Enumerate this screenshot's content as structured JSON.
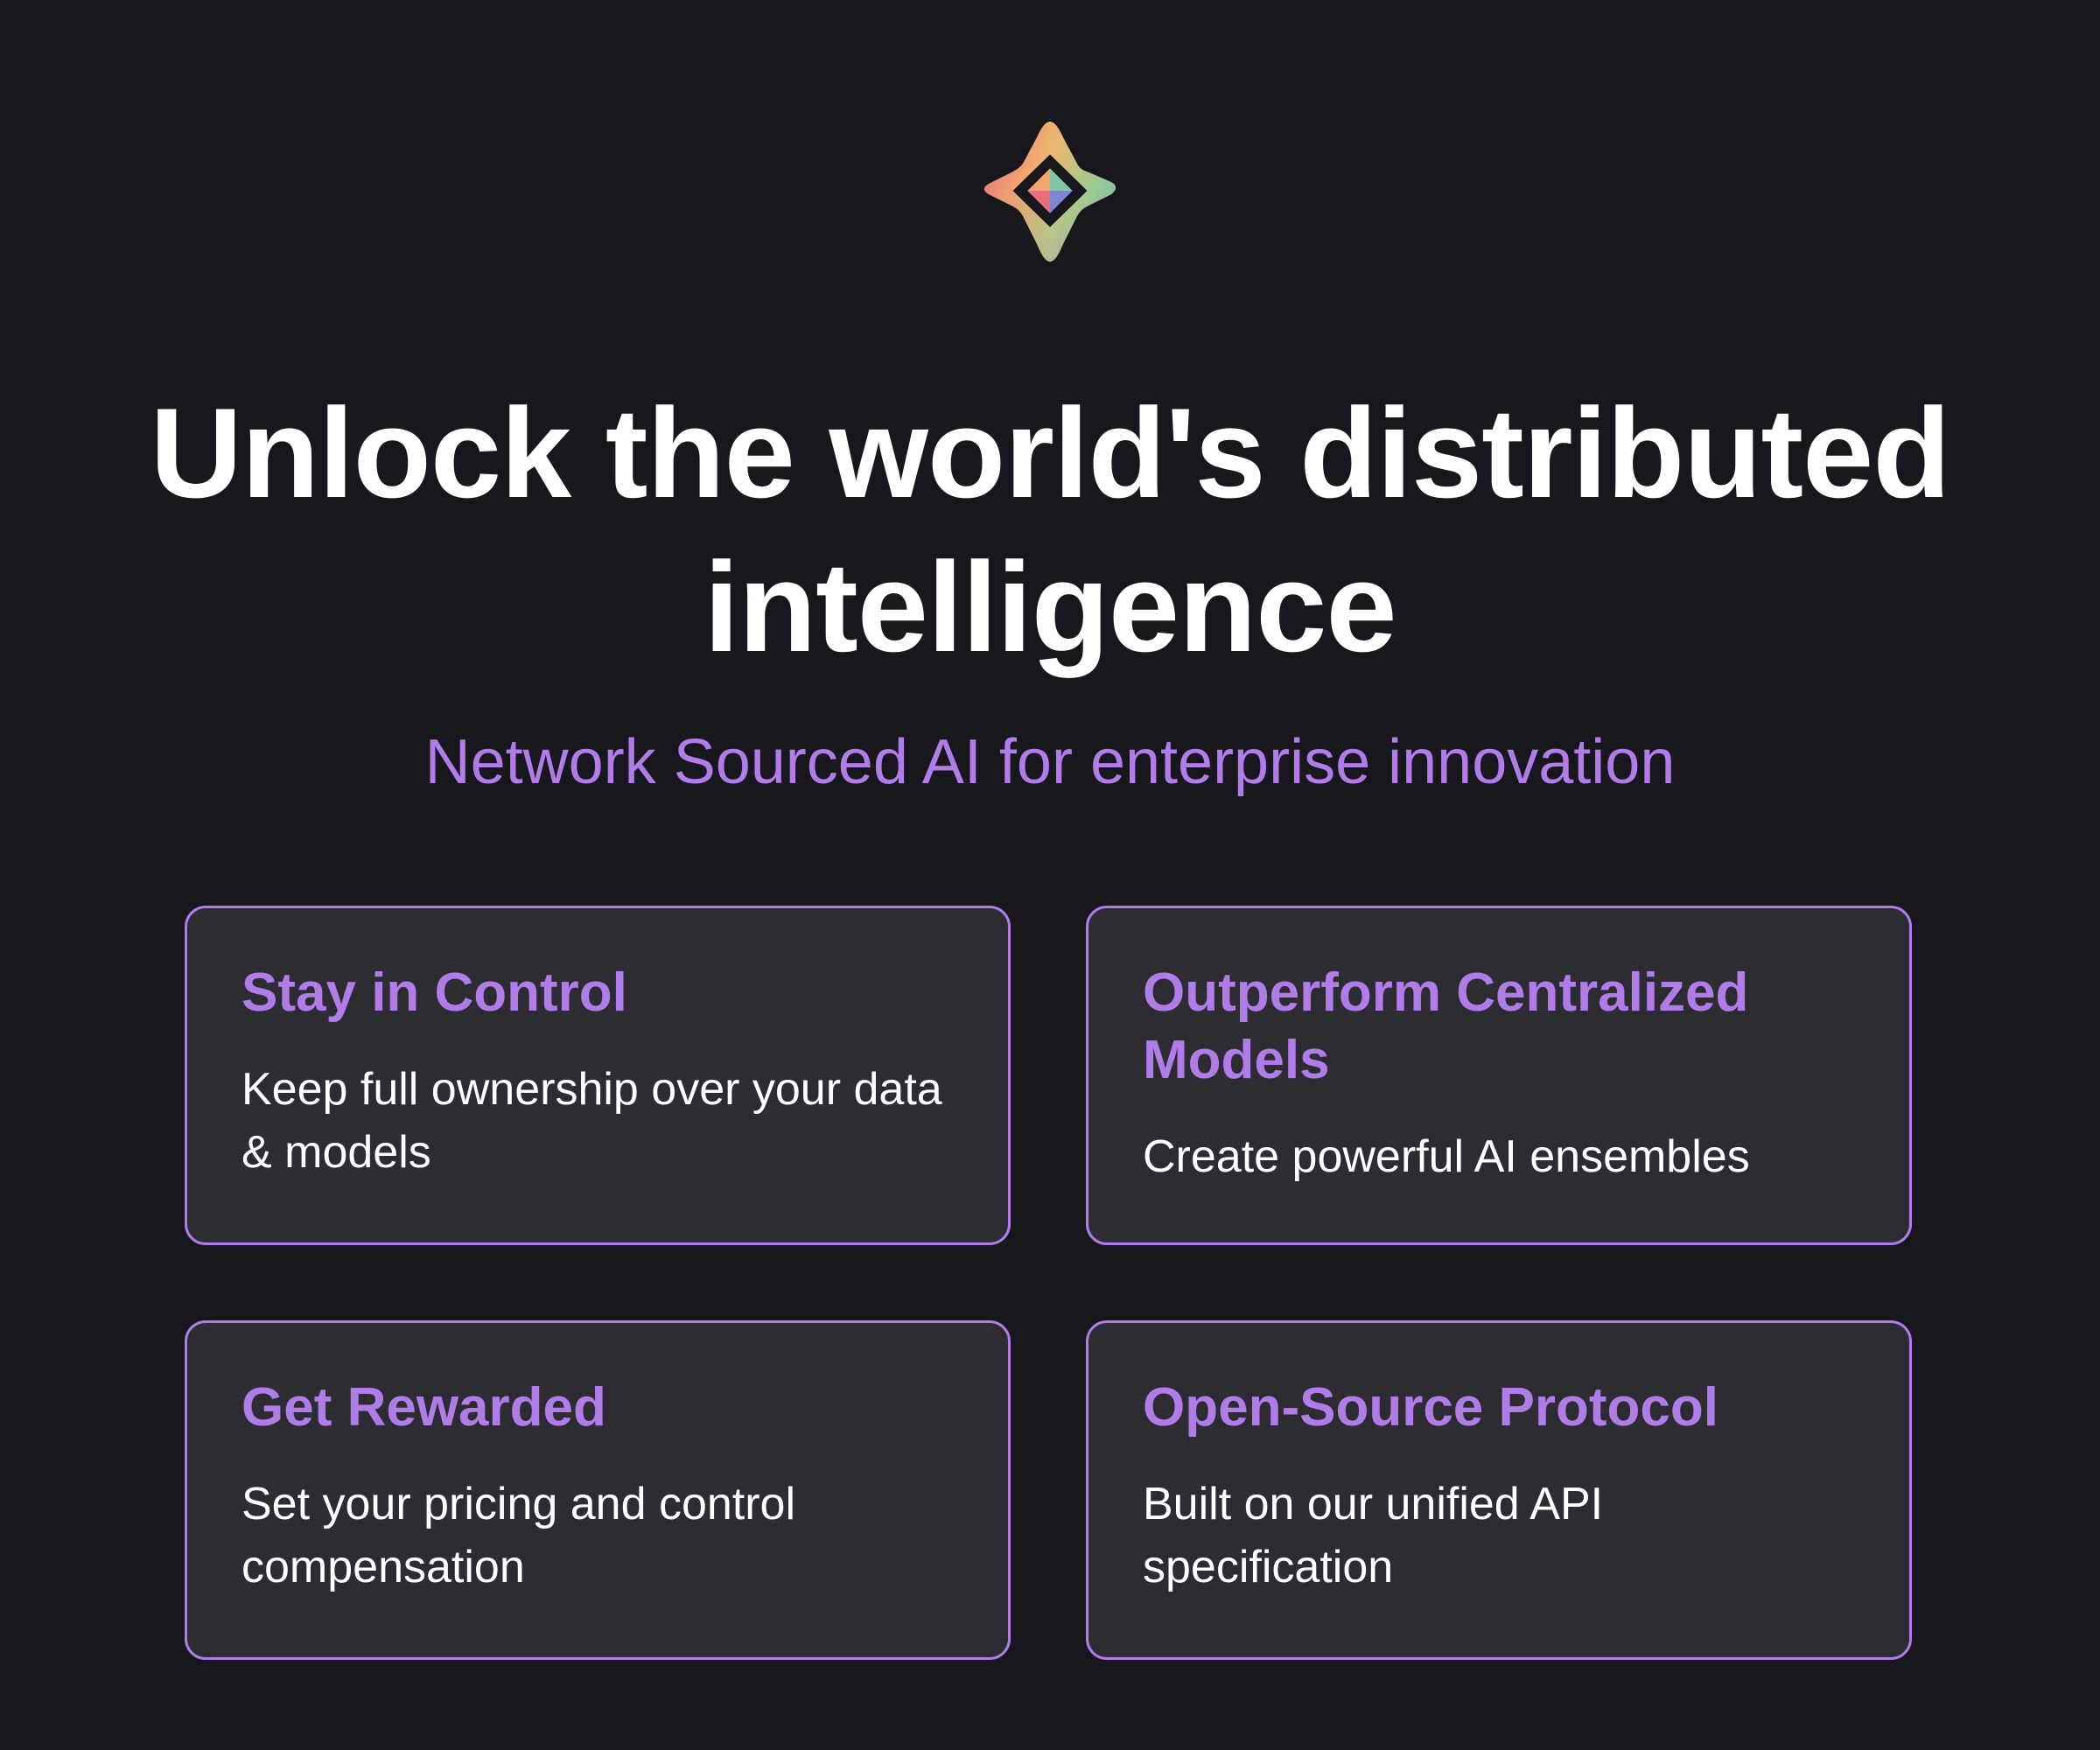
{
  "hero": {
    "logo_icon": "four-point-star-gradient-logo-icon",
    "headline": "Unlock the world's distributed intelligence",
    "subtitle": "Network Sourced AI for enterprise innovation"
  },
  "features": [
    {
      "title": "Stay in Control",
      "description": "Keep full ownership over your data & models"
    },
    {
      "title": "Outperform Centralized Models",
      "description": "Create powerful AI ensembles"
    },
    {
      "title": "Get Rewarded",
      "description": "Set your pricing and control compensation"
    },
    {
      "title": "Open-Source Protocol",
      "description": "Built on our unified API specification"
    }
  ],
  "colors": {
    "background": "#18171d",
    "accent": "#b07ce8",
    "card_background": "#2d2c33",
    "text": "#ffffff"
  }
}
